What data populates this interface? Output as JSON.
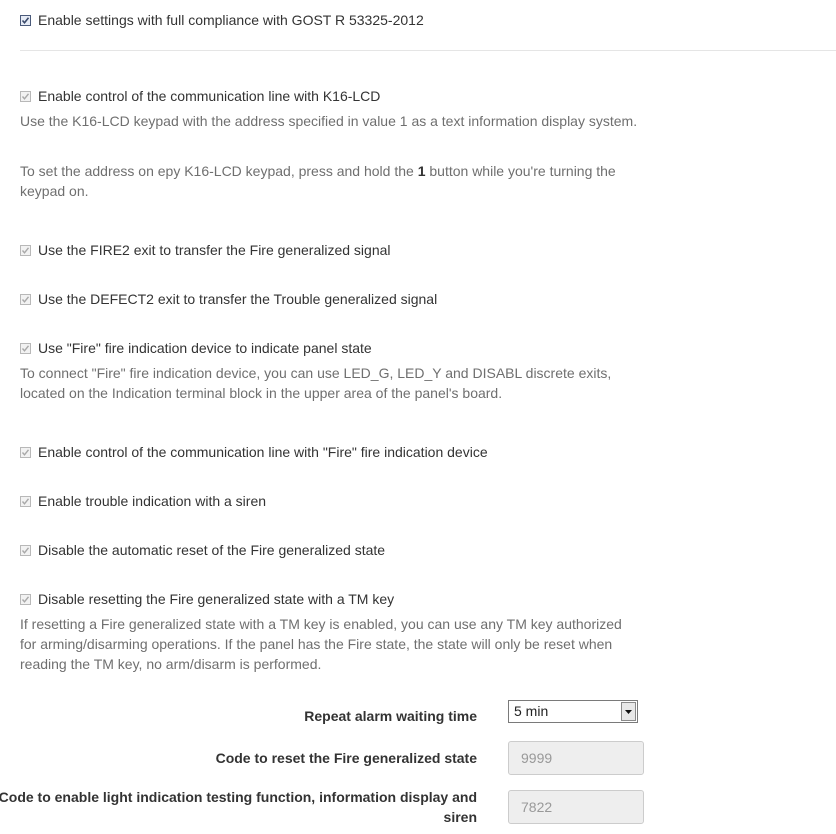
{
  "settings": {
    "gost_label": "Enable settings with full compliance with GOST R 53325-2012",
    "k16_label": "Enable control of the communication line with K16-LCD",
    "k16_desc1": "Use the K16-LCD keypad with the address specified in value 1 as a text information display system.",
    "k16_desc2_pre": "To set the address on epy K16-LCD keypad, press and hold the ",
    "k16_desc2_bold": "1",
    "k16_desc2_post": " button while you're turning the keypad on.",
    "fire2_label": "Use the FIRE2 exit to transfer the Fire generalized signal",
    "defect2_label": "Use the DEFECT2 exit to transfer the Trouble generalized signal",
    "fire_device_label": "Use \"Fire\" fire indication device to indicate panel state",
    "fire_device_desc": "To connect \"Fire\" fire indication device, you can use LED_G, LED_Y and DISABL discrete exits, located on the Indication terminal block in the upper area of the panel's board.",
    "fire_line_label": "Enable control of the communication line with \"Fire\" fire indication device",
    "siren_label": "Enable trouble indication with a siren",
    "auto_reset_label": "Disable the automatic reset of the Fire generalized state",
    "tm_reset_label": "Disable resetting the Fire generalized state with a TM key",
    "tm_reset_desc": "If resetting a Fire generalized state with a TM key is enabled, you can use any TM key authorized for arming/disarming operations. If the panel has the Fire state, the state will only be reset when reading the TM key, no arm/disarm is performed."
  },
  "fields": {
    "repeat_alarm_label": "Repeat alarm waiting time",
    "repeat_alarm_value": "5 min",
    "reset_code_label": "Code to reset the Fire generalized state",
    "reset_code_value": "9999",
    "test_code_label": "Code to enable light indication testing function, information display and siren",
    "test_code_value": "7822"
  }
}
